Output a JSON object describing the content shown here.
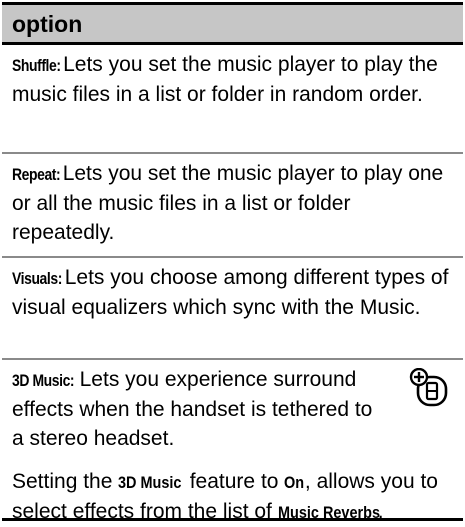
{
  "table": {
    "header": "option",
    "rows": [
      {
        "term": "Shuffle:",
        "description": " Lets you set the music player to play the music files in a list or folder in random order."
      },
      {
        "term": "Repeat:",
        "description": " Lets you set the music player to play one or all the music files in a list or folder repeatedly."
      },
      {
        "term": "Visuals:",
        "description": " Lets you choose among different types of visual equalizers which sync with the Music."
      },
      {
        "term": "3D Music:",
        "description": " Lets you experience surround effects when the handset is tethered to a stereo headset.",
        "icon": "optional-feature-icon",
        "note": {
          "part1": "Setting the ",
          "bold1": "3D Music",
          "part2": " feature to ",
          "bold2": "On",
          "part3": ", allows you to select effects from the list of ",
          "bold3": "Music Reverbs",
          "part4": "."
        }
      }
    ]
  }
}
